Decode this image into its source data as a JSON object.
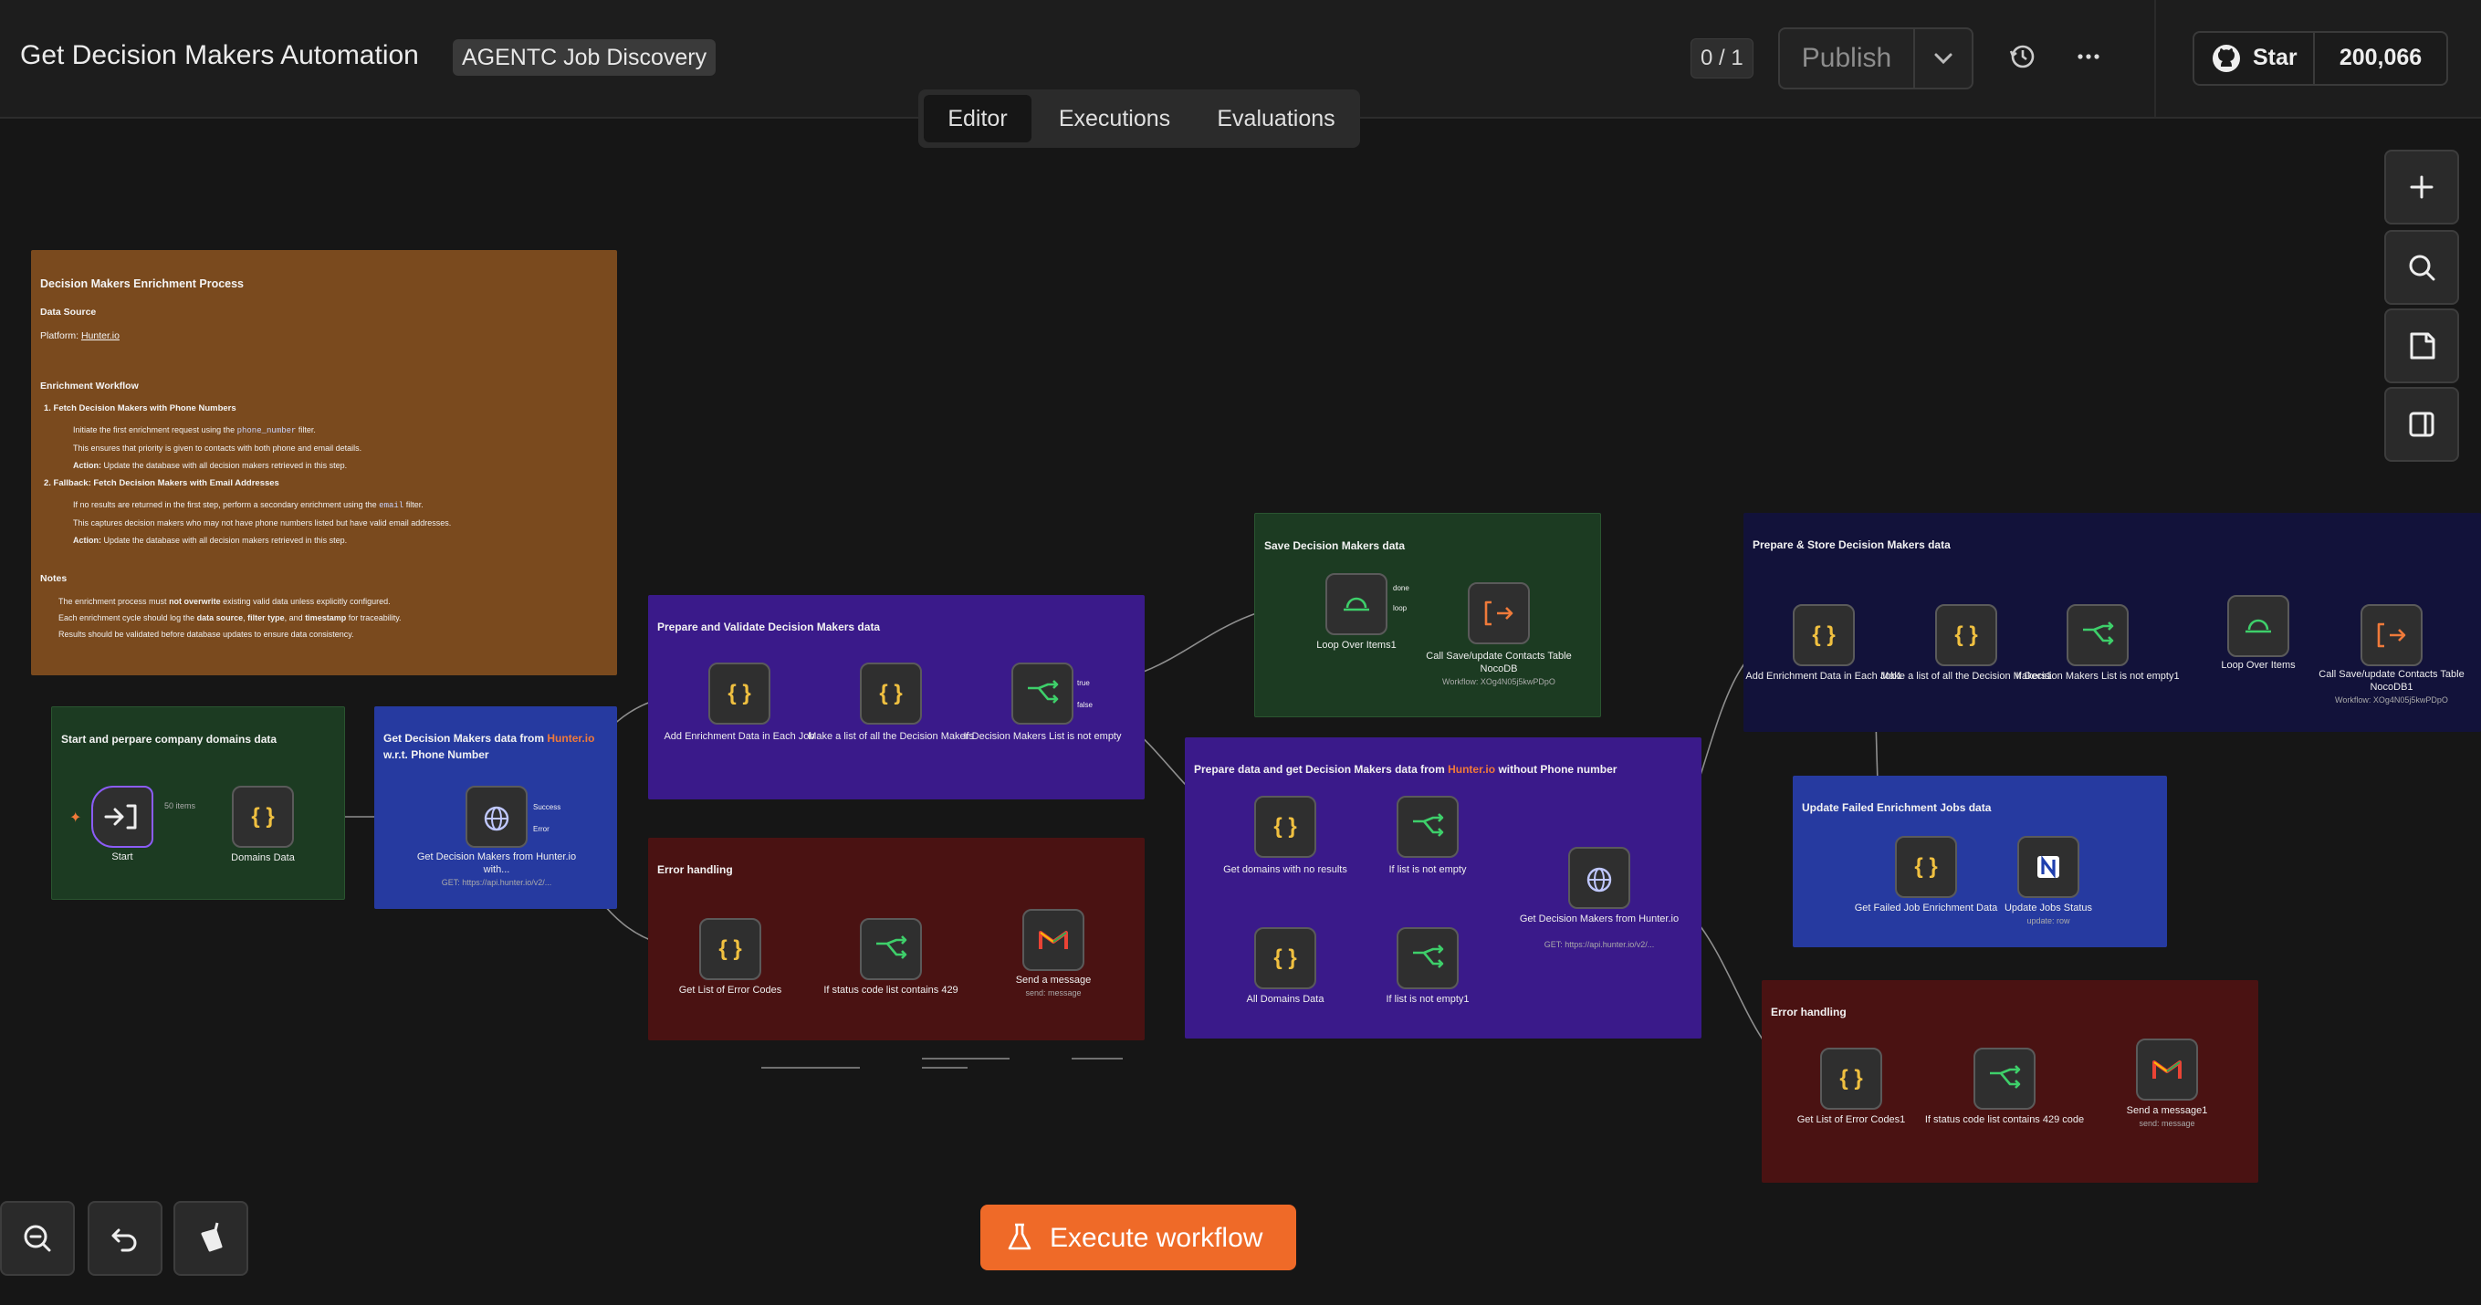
{
  "header": {
    "workflow_title": "Get Decision Makers Automation",
    "project_badge": "AGENTC Job Discovery",
    "counter": "0 / 1",
    "publish_label": "Publish",
    "github_star_label": "Star",
    "github_star_count": "200,066"
  },
  "tabs": [
    "Editor",
    "Executions",
    "Evaluations"
  ],
  "execute_label": "Execute workflow",
  "colors": {
    "brown_sticky": "#7a4a1e",
    "green_sticky": "#1c3b22",
    "blue_sticky": "#263aa0",
    "purple_sticky": "#3a1a8a",
    "red_sticky": "#4a1212",
    "navy_sticky": "#12123a",
    "accent_orange": "#ef6a28"
  },
  "note": {
    "title": "Decision Makers Enrichment Process",
    "data_source_heading": "Data Source",
    "platform_prefix": "Platform: ",
    "platform_link": "Hunter.io",
    "workflow_heading": "Enrichment Workflow",
    "step1_title": "1.  Fetch Decision Makers with Phone Numbers",
    "step1_line1_pre": "Initiate the first enrichment request using the ",
    "step1_line1_code": "phone_number",
    "step1_line1_post": " filter.",
    "step1_line2": "This ensures that priority is given to contacts with both phone and email details.",
    "step1_action_label": "Action:",
    "step1_action": " Update the database with all decision makers retrieved in this step.",
    "step2_title": "2.  Fallback: Fetch Decision Makers with Email Addresses",
    "step2_line1_pre": "If no results are returned in the first step, perform a secondary enrichment using the ",
    "step2_line1_code": "email",
    "step2_line1_post": " filter.",
    "step2_line2": "This captures decision makers who may not have phone numbers listed but have valid email addresses.",
    "step2_action_label": "Action:",
    "step2_action": " Update the database with all decision makers retrieved in this step.",
    "notes_heading": "Notes",
    "notes_line1_pre": "The enrichment process must ",
    "notes_line1_bold": "not overwrite",
    "notes_line1_post": " existing valid data unless explicitly configured.",
    "notes_line2_pre": "Each enrichment cycle should log the ",
    "notes_line2_b1": "data source",
    "notes_line2_mid1": ", ",
    "notes_line2_b2": "filter type",
    "notes_line2_mid2": ", and ",
    "notes_line2_b3": "timestamp",
    "notes_line2_post": " for traceability.",
    "notes_line3": "Results should be validated before database updates to ensure data consistency."
  },
  "groups": {
    "start": "Start and perpare company domains data",
    "hunter_phone_pre": "Get Decision Makers data from ",
    "hunter_phone_link": "Hunter.io",
    "hunter_phone_post": "w.r.t. Phone Number",
    "prepare_validate": "Prepare and Validate Decision Makers data",
    "error1": "Error handling",
    "save": "Save Decision Makers data",
    "without_phone_pre": "Prepare data and get Decision Makers data from ",
    "without_phone_link": "Hunter.io",
    "without_phone_post": " without Phone number",
    "prepare_store": "Prepare & Store Decision Makers data",
    "update_failed": "Update Failed Enrichment Jobs data",
    "error2": "Error handling"
  },
  "nodes": {
    "start": "Start",
    "domains_data": "Domains Data",
    "items_badge": "50 items",
    "hunter1": "Get Decision Makers from Hunter.io with...",
    "hunter1_sub": "GET: https://api.hunter.io/v2/...",
    "add_enrich": "Add Enrichment Data in Each Job",
    "make_list": "Make a list of all the Decision Makers",
    "if_list": "If Decision Makers List is not empty",
    "get_errors": "Get List of Error Codes",
    "if_429": "If status code list contains 429",
    "send_msg": "Send a message",
    "send_msg_sub": "send: message",
    "loop1": "Loop Over Items1",
    "call_save": "Call Save/update Contacts Table NocoDB",
    "call_save_sub": "Workflow: XOg4N05j5kwPDpO",
    "get_domains": "Get domains with no results",
    "if_list_empty": "If list is not empty",
    "all_domains": "All Domains Data",
    "if_list_empty1": "If list is not empty1",
    "hunter2": "Get Decision Makers from Hunter.io",
    "hunter2_sub": "GET: https://api.hunter.io/v2/...",
    "add_enrich1": "Add Enrichment Data in Each Job1",
    "make_list1": "Make a list of all the Decision Makers1",
    "if_list1": "If Decision Makers List is not empty1",
    "loop2": "Loop Over Items",
    "call_save1": "Call Save/update Contacts Table NocoDB1",
    "call_save1_sub": "Workflow: XOg4N05j5kwPDpO",
    "get_failed": "Get Failed Job Enrichment Data",
    "update_jobs": "Update Jobs Status",
    "update_jobs_sub": "update: row",
    "get_errors1": "Get List of Error Codes1",
    "if_429_1": "If status code list contains 429 code",
    "send_msg1": "Send a message1",
    "send_msg1_sub": "send: message"
  },
  "port_labels": {
    "done": "done",
    "loop": "loop",
    "true": "true",
    "false": "false",
    "success": "Success",
    "error": "Error"
  }
}
